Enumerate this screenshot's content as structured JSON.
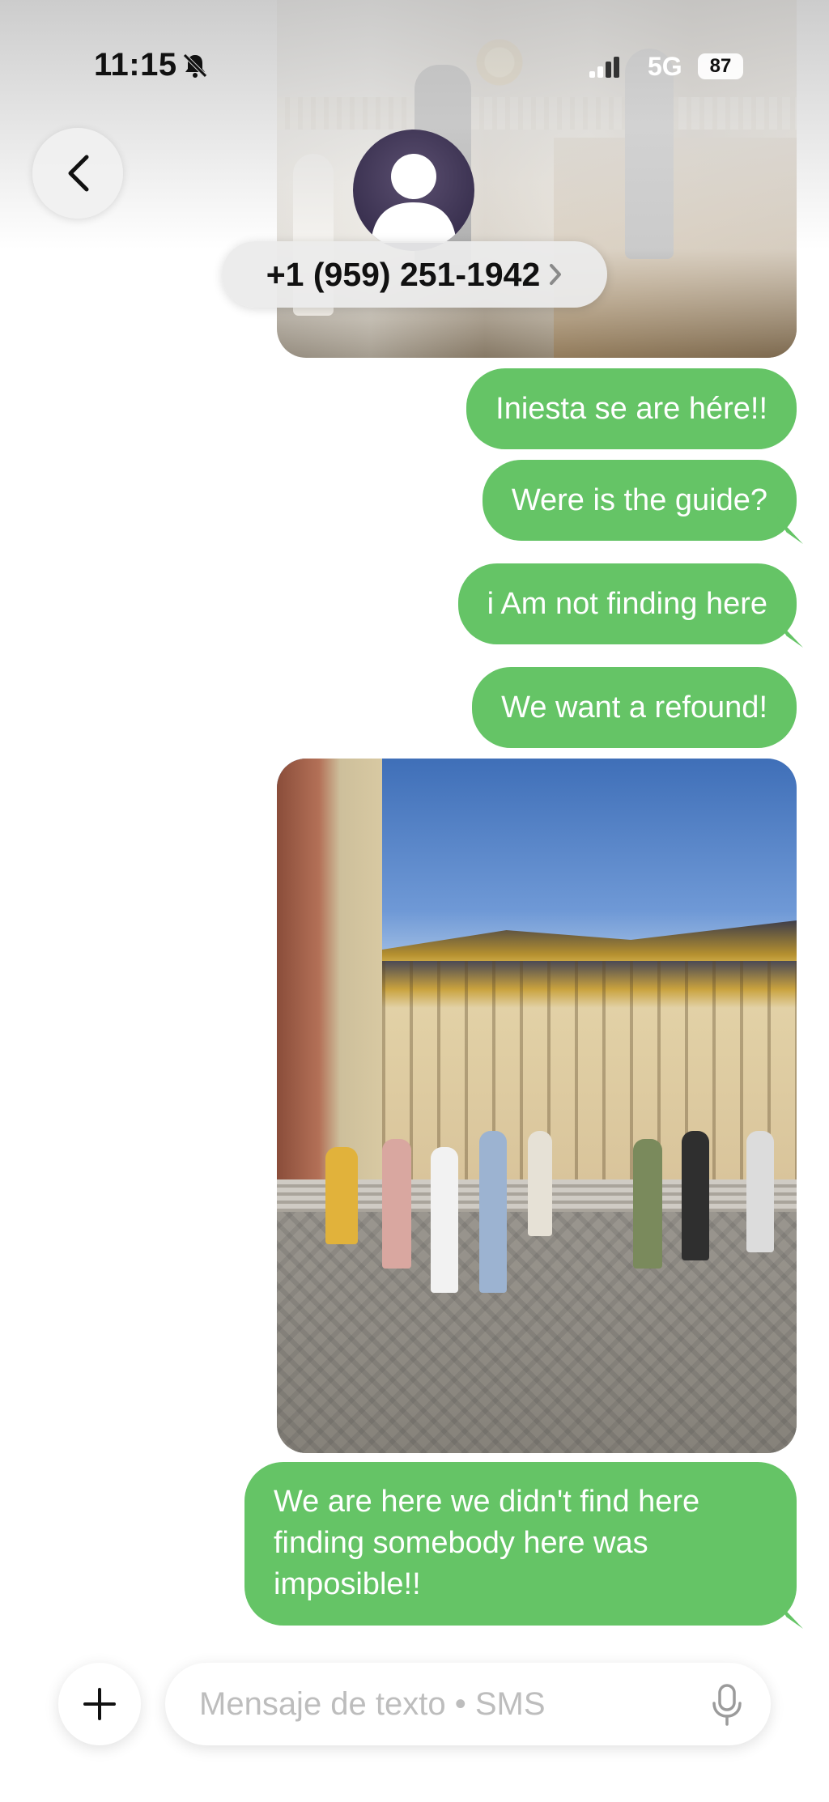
{
  "status_bar": {
    "time": "11:15",
    "network": "5G",
    "battery": "87"
  },
  "header": {
    "contact": "+1 (959) 251-1942",
    "icons": [
      "back-icon",
      "avatar-person-icon",
      "chevron-right-icon",
      "bell-off-icon",
      "signal-icon"
    ]
  },
  "messages": [
    {
      "type": "image",
      "description_icon": "photo-attachment"
    },
    {
      "type": "text",
      "text": "Iniesta se are hére!!"
    },
    {
      "type": "text",
      "text": "Were  is the guide?"
    },
    {
      "type": "text",
      "text": "i Am not  finding here"
    },
    {
      "type": "text",
      "text": "We want a refound!"
    },
    {
      "type": "image",
      "description_icon": "photo-attachment"
    },
    {
      "type": "text",
      "text": "We are here we didn't find here finding somebody here was imposible!!"
    }
  ],
  "composer": {
    "placeholder": "Mensaje de texto • SMS",
    "icons": [
      "plus-icon",
      "mic-icon"
    ]
  },
  "colors": {
    "bubble": "#65c466",
    "bubble_text": "#ffffff",
    "placeholder": "#bdbdbd"
  }
}
